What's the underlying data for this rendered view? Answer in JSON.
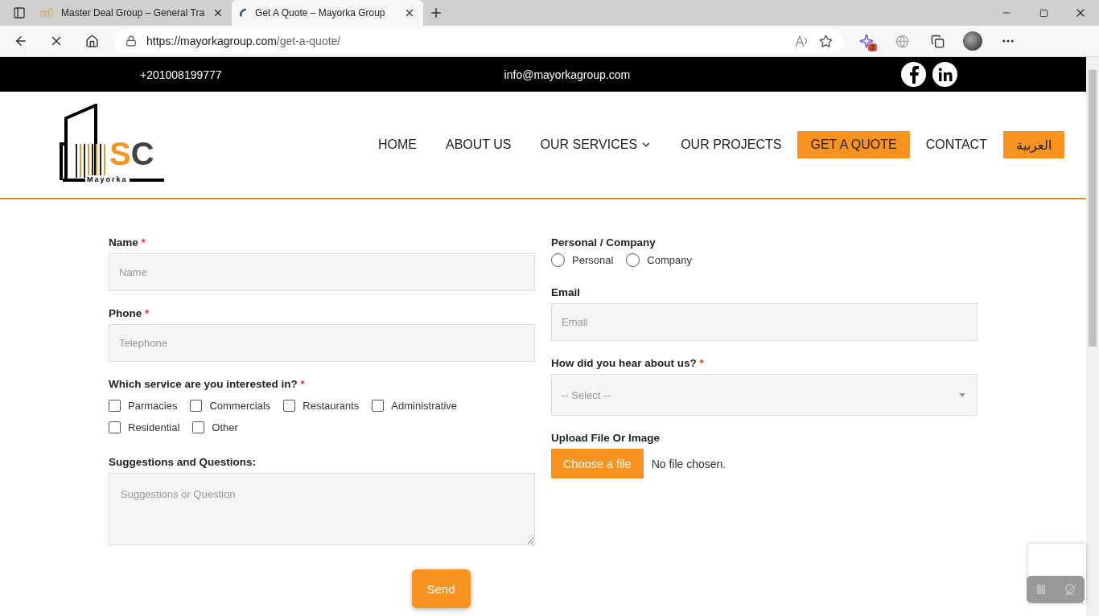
{
  "browser": {
    "tabs": [
      {
        "title": "Master Deal Group – General Tra",
        "selected": false
      },
      {
        "title": "Get A Quote – Mayorka Group",
        "selected": true
      }
    ],
    "url_host": "https://mayorkagroup.com",
    "url_path": "/get-a-quote/",
    "extension_badge": "3"
  },
  "topbar": {
    "phone": "+201008199777",
    "email": "info@mayorkagroup.com"
  },
  "logo": {
    "letter_1": "S",
    "letter_2": "C",
    "name": "Mayorka"
  },
  "nav": [
    {
      "label": "HOME",
      "kind": "link",
      "dropdown": false
    },
    {
      "label": "ABOUT US",
      "kind": "link",
      "dropdown": false
    },
    {
      "label": "OUR SERVICES",
      "kind": "link",
      "dropdown": true
    },
    {
      "label": "OUR PROJECTS",
      "kind": "link",
      "dropdown": false
    },
    {
      "label": "GET A QUOTE",
      "kind": "button",
      "dropdown": false
    },
    {
      "label": "CONTACT",
      "kind": "link",
      "dropdown": false
    },
    {
      "label": "العربية",
      "kind": "button",
      "dropdown": false
    }
  ],
  "form": {
    "name": {
      "label": "Name",
      "required_mark": "*",
      "placeholder": "Name"
    },
    "phone": {
      "label": "Phone",
      "required_mark": "*",
      "placeholder": "Telephone"
    },
    "services": {
      "label": "Which service are you interested in?",
      "required_mark": "*",
      "options": [
        {
          "label": "Parmacies",
          "checked": false
        },
        {
          "label": "Commercials",
          "checked": false
        },
        {
          "label": "Restaurants",
          "checked": false
        },
        {
          "label": "Administrative",
          "checked": false
        },
        {
          "label": "Residential",
          "checked": false
        },
        {
          "label": "Other",
          "checked": false
        }
      ]
    },
    "suggestions": {
      "label": "Suggestions and Questions:",
      "placeholder": "Suggestions or Question"
    },
    "type": {
      "label": "Personal / Company",
      "options": [
        {
          "label": "Personal",
          "selected": false
        },
        {
          "label": "Company",
          "selected": false
        }
      ]
    },
    "email": {
      "label": "Email",
      "placeholder": "Email"
    },
    "source": {
      "label": "How did you hear about us?",
      "required_mark": "*",
      "value": "-- Select --"
    },
    "upload": {
      "label": "Upload File Or Image",
      "button": "Choose a file",
      "status": "No file chosen."
    },
    "submit": "Send"
  }
}
